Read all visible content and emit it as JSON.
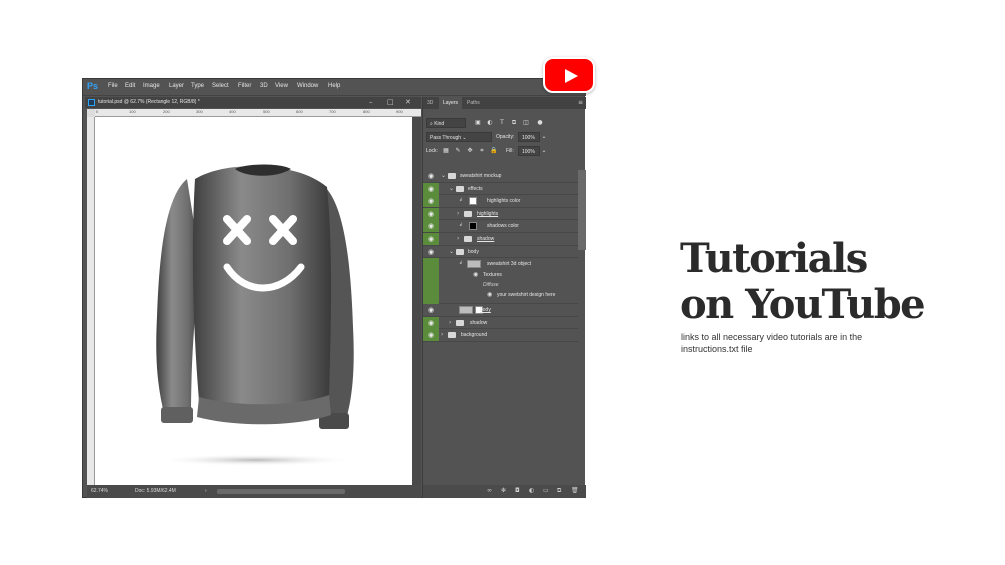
{
  "app": {
    "logo": "Ps",
    "menu": [
      "File",
      "Edit",
      "Image",
      "Layer",
      "Type",
      "Select",
      "Filter",
      "3D",
      "View",
      "Window",
      "Help"
    ]
  },
  "document": {
    "tab_title": "tutorial.psd @ 62.7% (Rectangle 12, RGB/8) *",
    "ruler_ticks": [
      "0",
      "100",
      "200",
      "300",
      "400",
      "500",
      "600",
      "700",
      "800",
      "900"
    ],
    "zoom": "62.74%",
    "doc_size": "Doc: 5.93M/62.4M"
  },
  "panel": {
    "tabs": [
      "3D",
      "Layers",
      "Paths"
    ],
    "kind": "Kind",
    "blend_mode": "Pass Through",
    "opacity_label": "Opacity:",
    "opacity": "100%",
    "lock_label": "Lock:",
    "fill_label": "Fill:",
    "fill": "100%",
    "layers": {
      "sweatshirt_mockup": "sweatshirt mockup",
      "effects": "effects",
      "highlights_color": "highlights color",
      "highlights": "highlights",
      "shadows_color": "shadows color",
      "shadow_sub": "shadow",
      "body_group": "body",
      "object": "sweatshirt 3d object",
      "textures": "Textures",
      "diffuse": "Diffuse",
      "design": "your swetshirt design here",
      "body_layer": "body",
      "shadow": "shadow",
      "background": "background"
    }
  },
  "promo": {
    "headline_line1": "Tutorials",
    "headline_line2": "on YouTube",
    "subtext": "links to all necessary video tutorials are in the instructions.txt file"
  },
  "colors": {
    "ps_blue": "#2fa3f7",
    "panel_bg": "#535353",
    "visible_green": "#5b8c3c",
    "youtube_red": "#ff0000",
    "headline": "#2b2b2b"
  },
  "icons": {
    "eye": "eye-icon",
    "folder": "folder-icon",
    "youtube": "youtube-logo-icon"
  }
}
